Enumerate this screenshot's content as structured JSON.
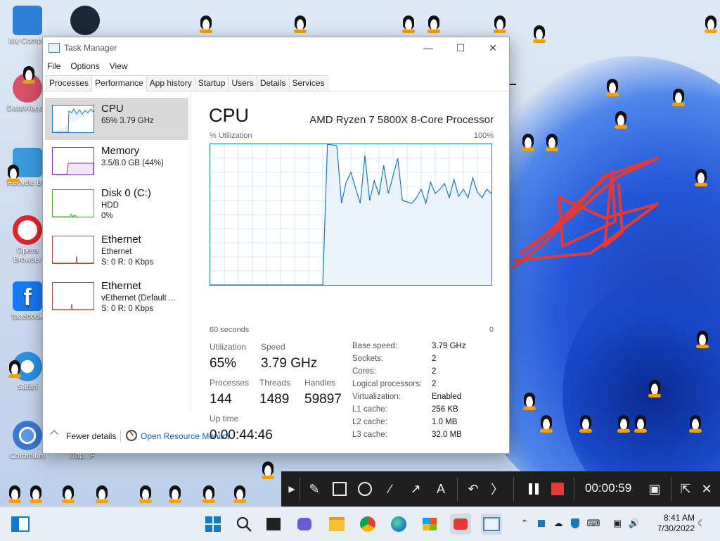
{
  "desktop": {
    "icons": [
      {
        "label": "My Compu",
        "color": "#2f7fd6"
      },
      {
        "label": "DataWagon",
        "color": "#d8506a"
      },
      {
        "label": "Recycle Bin",
        "color": "#3a9bdc"
      },
      {
        "label": "Opera Browser",
        "color": "#e0242a"
      },
      {
        "label": "facebook",
        "color": "#1877f2"
      },
      {
        "label": "Safari",
        "color": "#2a90e0"
      },
      {
        "label": "Chromium",
        "color": "#3a78d0"
      },
      {
        "label": "iTop...F",
        "color": "#5a6f8a"
      }
    ]
  },
  "taskmanager": {
    "title": "Task Manager",
    "menu": [
      "File",
      "Options",
      "View"
    ],
    "tabs": [
      "Processes",
      "Performance",
      "App history",
      "Startup",
      "Users",
      "Details",
      "Services"
    ],
    "active_tab": "Performance",
    "sidebar": [
      {
        "name": "CPU",
        "line2": "65%  3.79 GHz",
        "line3": "",
        "color": "#1a78c2"
      },
      {
        "name": "Memory",
        "line2": "3.5/8.0 GB (44%)",
        "line3": "",
        "color": "#8b2ea8"
      },
      {
        "name": "Disk 0 (C:)",
        "line2": "HDD",
        "line3": "0%",
        "color": "#4caa3a"
      },
      {
        "name": "Ethernet",
        "line2": "Ethernet",
        "line3": "S: 0  R: 0 Kbps",
        "color": "#a0522d"
      },
      {
        "name": "Ethernet",
        "line2": "vEthernet (Default ...",
        "line3": "S: 0  R: 0 Kbps",
        "color": "#a0522d"
      }
    ],
    "cpu": {
      "title": "CPU",
      "model": "AMD Ryzen 7 5800X 8-Core Processor",
      "util_label": "% Utilization",
      "util_max": "100%",
      "x_left": "60 seconds",
      "x_right": "0",
      "stats": {
        "utilization_label": "Utilization",
        "utilization": "65%",
        "speed_label": "Speed",
        "speed": "3.79 GHz",
        "processes_label": "Processes",
        "processes": "144",
        "threads_label": "Threads",
        "threads": "1489",
        "handles_label": "Handles",
        "handles": "59897",
        "uptime_label": "Up time",
        "uptime": "0:00:44:46"
      },
      "specs": [
        {
          "k": "Base speed:",
          "v": "3.79 GHz"
        },
        {
          "k": "Sockets:",
          "v": "2"
        },
        {
          "k": "Cores:",
          "v": "2"
        },
        {
          "k": "Logical processors:",
          "v": "2"
        },
        {
          "k": "Virtualization:",
          "v": "Enabled"
        },
        {
          "k": "L1 cache:",
          "v": "256 KB"
        },
        {
          "k": "L2 cache:",
          "v": "1.0 MB"
        },
        {
          "k": "L3 cache:",
          "v": "32.0 MB"
        }
      ]
    },
    "footer": {
      "fewer": "Fewer details",
      "resource_monitor": "Open Resource Monitor"
    }
  },
  "chart_data": {
    "type": "area",
    "ylim": [
      0,
      100
    ],
    "x": [
      0,
      3,
      6,
      8,
      9,
      10,
      11,
      12,
      13,
      14,
      16,
      17,
      18,
      19,
      20,
      22,
      23,
      24,
      25,
      27,
      28,
      29,
      30,
      32,
      33,
      34,
      35,
      36,
      37,
      38,
      40,
      41,
      43,
      44,
      45,
      46,
      47,
      48,
      49,
      50,
      51,
      52,
      53,
      54,
      55,
      56,
      57,
      58,
      59,
      60
    ],
    "values": [
      0,
      0,
      0,
      0,
      0,
      0,
      0,
      0,
      0,
      0,
      0,
      0,
      0,
      0,
      0,
      0,
      0,
      0,
      100,
      99,
      58,
      73,
      80,
      58,
      92,
      60,
      74,
      64,
      85,
      65,
      90,
      60,
      58,
      62,
      68,
      58,
      73,
      65,
      68,
      72,
      62,
      75,
      63,
      68,
      62,
      76,
      66,
      62,
      68,
      65
    ]
  },
  "recbar": {
    "timer": "00:00:59"
  },
  "taskbar": {
    "time": "8:41 AM",
    "date": "7/30/2022"
  }
}
